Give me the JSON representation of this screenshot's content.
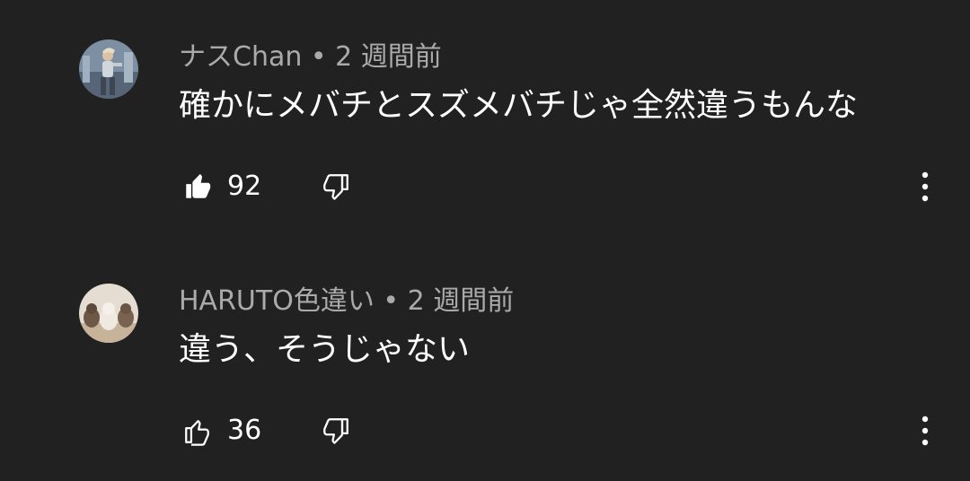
{
  "comments": [
    {
      "author": "ナスChan",
      "separator": " • ",
      "time": "2 週間前",
      "text": "確かにメバチとスズメバチじゃ全然違うもんな",
      "likes": "92",
      "liked": true,
      "avatar": "user-avatar-photo-person"
    },
    {
      "author": "HARUTO色違い",
      "separator": " • ",
      "time": "2 週間前",
      "text": "違う、そうじゃない",
      "likes": "36",
      "liked": false,
      "avatar": "user-avatar-photo-animals"
    }
  ],
  "icons": {
    "like": "thumbs-up-icon",
    "dislike": "thumbs-down-icon",
    "more": "more-vertical-icon"
  },
  "colors": {
    "background": "#212121",
    "meta_text": "#aaaaaa",
    "body_text": "#ffffff"
  }
}
